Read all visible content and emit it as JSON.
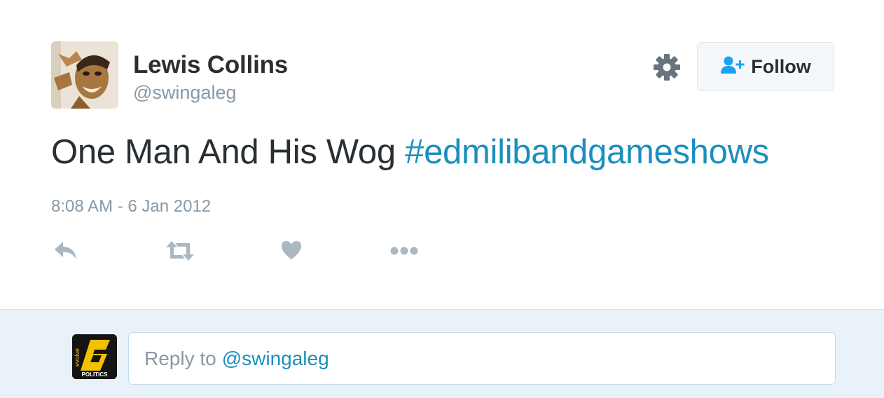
{
  "tweet": {
    "author_name": "Lewis Collins",
    "author_handle": "@swingaleg",
    "text": "One Man And His Wog",
    "hashtag": "#edmilibandgameshows",
    "timestamp": "8:08 AM - 6 Jan 2012",
    "follow_label": "Follow"
  },
  "icons": {
    "settings": "gear-icon",
    "follow": "add-user-icon",
    "reply": "reply-icon",
    "retweet": "retweet-icon",
    "like": "heart-icon",
    "more": "more-icon"
  },
  "reply_box": {
    "prefix": "Reply to",
    "mention": "@swingaleg",
    "avatar_logo_text": "evolve POLITICS"
  },
  "colors": {
    "text": "#292f33",
    "muted": "#8899a6",
    "link": "#1b8fbd",
    "follow_icon": "#1da1f2",
    "reply_bar_bg": "#e8f2f8"
  }
}
